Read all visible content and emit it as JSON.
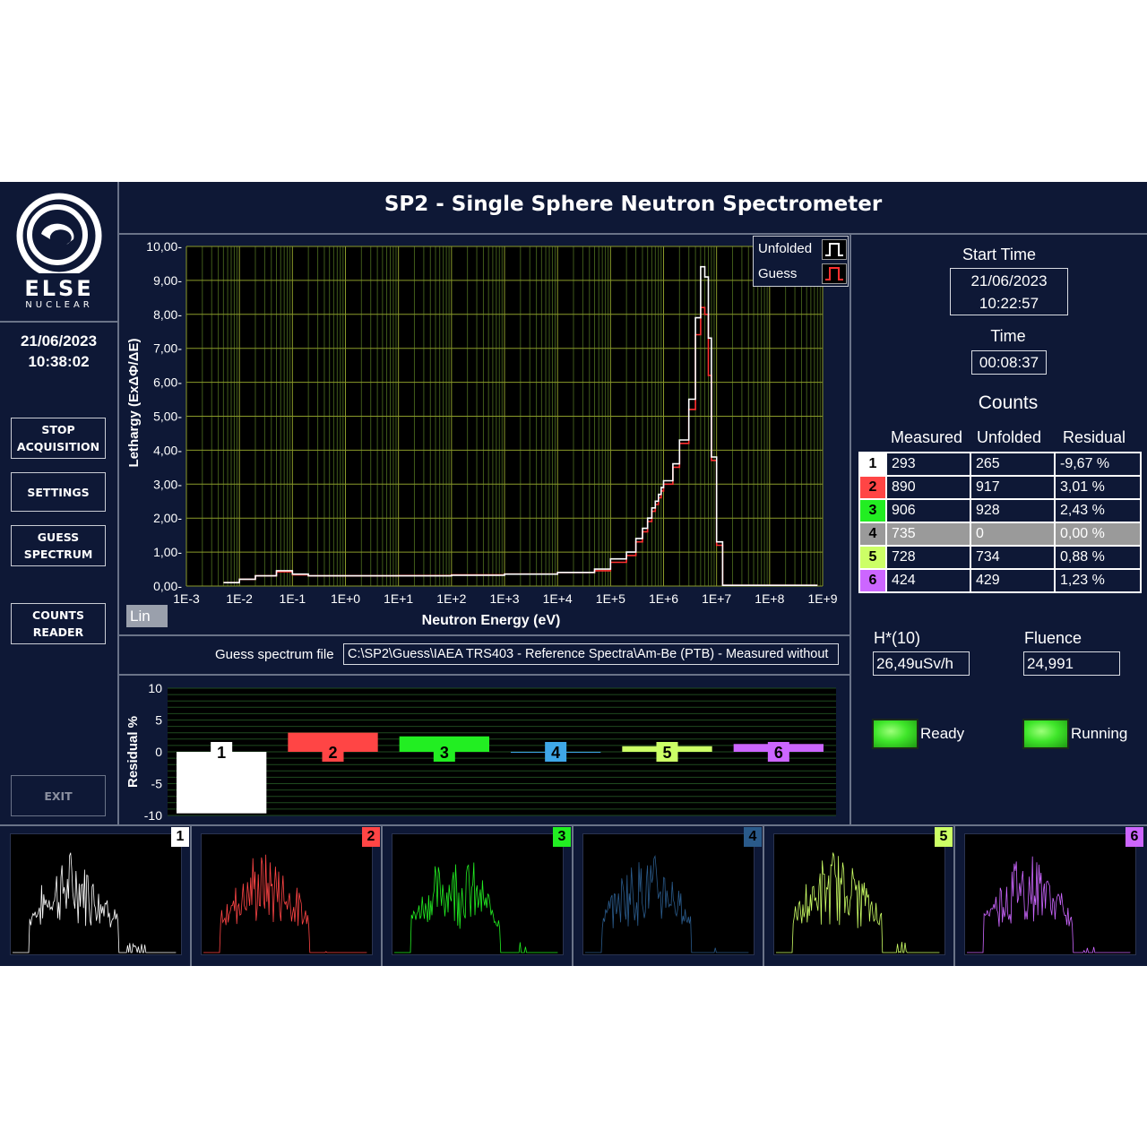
{
  "title": "SP2 - Single Sphere Neutron Spectrometer",
  "logo": {
    "line1": "ELSE",
    "line2": "NUCLEAR"
  },
  "clock": {
    "date": "21/06/2023",
    "time": "10:38:02"
  },
  "sidebar": {
    "stop_acquisition": "STOP ACQUISITION",
    "settings": "SETTINGS",
    "guess_spectrum": "GUESS SPECTRUM",
    "counts_reader": "COUNTS READER",
    "exit": "EXIT"
  },
  "main_chart": {
    "ylabel": "Lethargy (ExΔΦ/ΔE)",
    "xlabel": "Neutron Energy (eV)",
    "yticks": [
      "10,00",
      "9,00",
      "8,00",
      "7,00",
      "6,00",
      "5,00",
      "4,00",
      "3,00",
      "2,00",
      "1,00",
      "0,00"
    ],
    "xticks": [
      "1E-3",
      "1E-2",
      "1E-1",
      "1E+0",
      "1E+1",
      "1E+2",
      "1E+3",
      "1E+4",
      "1E+5",
      "1E+6",
      "1E+7",
      "1E+8",
      "1E+9"
    ],
    "scale_button": "Lin",
    "legend": [
      {
        "name": "Unfolded",
        "color": "#ffffff"
      },
      {
        "name": "Guess",
        "color": "#ff3030"
      }
    ]
  },
  "chart_data": [
    {
      "type": "line",
      "title": "",
      "xlabel": "Neutron Energy (eV)",
      "ylabel": "Lethargy (ExΔΦ/ΔE)",
      "xscale": "log",
      "xlim": [
        0.001,
        1000000000
      ],
      "ylim": [
        0,
        10
      ],
      "grid": true,
      "legend_position": "top-right",
      "x": [
        0.005,
        0.01,
        0.02,
        0.05,
        0.1,
        0.2,
        0.5,
        1,
        10,
        100,
        1000,
        10000,
        50000,
        100000,
        200000,
        300000,
        400000,
        500000,
        600000,
        700000,
        800000,
        900000,
        1000000,
        1500000,
        2000000,
        3000000,
        4000000,
        5000000,
        6000000,
        7000000,
        8000000,
        10000000,
        13000000,
        20000000,
        100000000,
        500000000
      ],
      "series": [
        {
          "name": "Unfolded",
          "color": "#ffffff",
          "values": [
            0.1,
            0.2,
            0.3,
            0.45,
            0.35,
            0.3,
            0.3,
            0.3,
            0.3,
            0.32,
            0.35,
            0.4,
            0.5,
            0.8,
            1.0,
            1.4,
            1.7,
            2.0,
            2.3,
            2.5,
            2.7,
            2.9,
            3.1,
            3.6,
            4.3,
            5.5,
            7.9,
            9.4,
            9.1,
            7.3,
            3.8,
            1.3,
            0.02,
            0.02,
            0.02,
            0.02
          ]
        },
        {
          "name": "Guess",
          "color": "#ff3030",
          "values": [
            0.1,
            0.2,
            0.3,
            0.42,
            0.33,
            0.3,
            0.3,
            0.3,
            0.31,
            0.33,
            0.35,
            0.4,
            0.45,
            0.7,
            0.9,
            1.3,
            1.6,
            1.9,
            2.2,
            2.4,
            2.6,
            2.8,
            3.0,
            3.5,
            4.2,
            5.2,
            7.4,
            8.2,
            8.0,
            6.2,
            3.7,
            1.2,
            0.02,
            0.02,
            0.02,
            0.02
          ]
        }
      ]
    },
    {
      "type": "bar",
      "title": "",
      "ylabel": "Residual %",
      "ylim": [
        -10,
        10
      ],
      "yticks": [
        "10",
        "5",
        "0",
        "-5",
        "-10"
      ],
      "categories": [
        "1",
        "2",
        "3",
        "4",
        "5",
        "6"
      ],
      "colors": [
        "#ffffff",
        "#ff4545",
        "#22ee22",
        "#3fa7e8",
        "#ccff66",
        "#cc66ff"
      ],
      "values": [
        -9.67,
        3.01,
        2.43,
        0.0,
        0.88,
        1.23
      ]
    }
  ],
  "guess_file": {
    "label": "Guess spectrum file",
    "value": "C:\\SP2\\Guess\\IAEA TRS403 - Reference Spectra\\Am-Be (PTB) - Measured without"
  },
  "start_time": {
    "label": "Start Time",
    "date": "21/06/2023",
    "time": "10:22:57"
  },
  "elapsed": {
    "label": "Time",
    "value": "00:08:37"
  },
  "counts": {
    "title": "Counts",
    "headers": [
      "Measured",
      "Unfolded",
      "Residual"
    ],
    "rows": [
      {
        "idx": "1",
        "color": "#ffffff",
        "measured": "293",
        "unfolded": "265",
        "residual": "-9,67 %"
      },
      {
        "idx": "2",
        "color": "#ff4545",
        "measured": "890",
        "unfolded": "917",
        "residual": "3,01 %"
      },
      {
        "idx": "3",
        "color": "#22ee22",
        "measured": "906",
        "unfolded": "928",
        "residual": "2,43 %"
      },
      {
        "idx": "4",
        "color": "#9a9a9a",
        "measured": "735",
        "unfolded": "0",
        "residual": "0,00 %"
      },
      {
        "idx": "5",
        "color": "#ccff66",
        "measured": "728",
        "unfolded": "734",
        "residual": "0,88 %"
      },
      {
        "idx": "6",
        "color": "#cc66ff",
        "measured": "424",
        "unfolded": "429",
        "residual": "1,23 %"
      }
    ]
  },
  "dose": {
    "label": "H*(10)",
    "value": "26,49uSv/h"
  },
  "fluence": {
    "label": "Fluence",
    "value": "24,991"
  },
  "status": {
    "ready": "Ready",
    "running": "Running"
  },
  "minis": [
    {
      "idx": "1",
      "color": "#ffffff"
    },
    {
      "idx": "2",
      "color": "#ff4545"
    },
    {
      "idx": "3",
      "color": "#22ee22"
    },
    {
      "idx": "4",
      "color": "#2a5a8a"
    },
    {
      "idx": "5",
      "color": "#ccff66"
    },
    {
      "idx": "6",
      "color": "#cc66ff"
    }
  ]
}
